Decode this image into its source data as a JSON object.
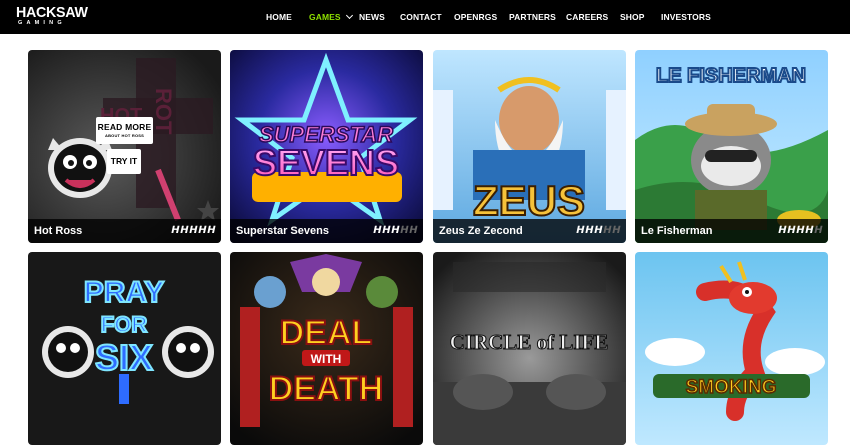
{
  "brand": {
    "name": "HACKSAW",
    "sub": "GAMING"
  },
  "nav": [
    {
      "label": "HOME",
      "active": false
    },
    {
      "label": "GAMES",
      "active": true,
      "has_dropdown": true
    },
    {
      "label": "NEWS",
      "active": false
    },
    {
      "label": "CONTACT",
      "active": false
    },
    {
      "label": "OPENRGS",
      "active": false
    },
    {
      "label": "PARTNERS",
      "active": false
    },
    {
      "label": "CAREERS",
      "active": false
    },
    {
      "label": "SHOP",
      "active": false
    },
    {
      "label": "INVESTORS",
      "active": false
    }
  ],
  "colors": {
    "accent": "#8ee000",
    "header_bg": "#000000",
    "caption_bg": "#000000"
  },
  "volatility_glyph": "H",
  "games": [
    {
      "name": "Hot Ross",
      "volatility": 5,
      "max_volatility": 5,
      "hovered": true,
      "read_more": "READ MORE",
      "read_more_sub": "ABOUT HOT ROSS",
      "try_it": "TRY IT",
      "art_text": "HOT"
    },
    {
      "name": "Superstar Sevens",
      "volatility": 3,
      "max_volatility": 5,
      "art_text": "SUPERSTAR",
      "art_text2": "SEVENS"
    },
    {
      "name": "Zeus Ze Zecond",
      "volatility": 3,
      "max_volatility": 5,
      "art_text": "ZEUS"
    },
    {
      "name": "Le Fisherman",
      "volatility": 4,
      "max_volatility": 5,
      "art_text": "LE FISHERMAN"
    },
    {
      "name": "Pray For Six",
      "art_text": "PRAY",
      "art_text2": "FOR",
      "art_text3": "SIX"
    },
    {
      "name": "Deal With Death",
      "art_text": "DEAL",
      "art_text2": "WITH",
      "art_text3": "DEATH"
    },
    {
      "name": "Circle of Life",
      "art_text": "CIRCLE of LIFE"
    },
    {
      "name": "Smoking Dragon",
      "art_text": "SMOKING"
    }
  ]
}
